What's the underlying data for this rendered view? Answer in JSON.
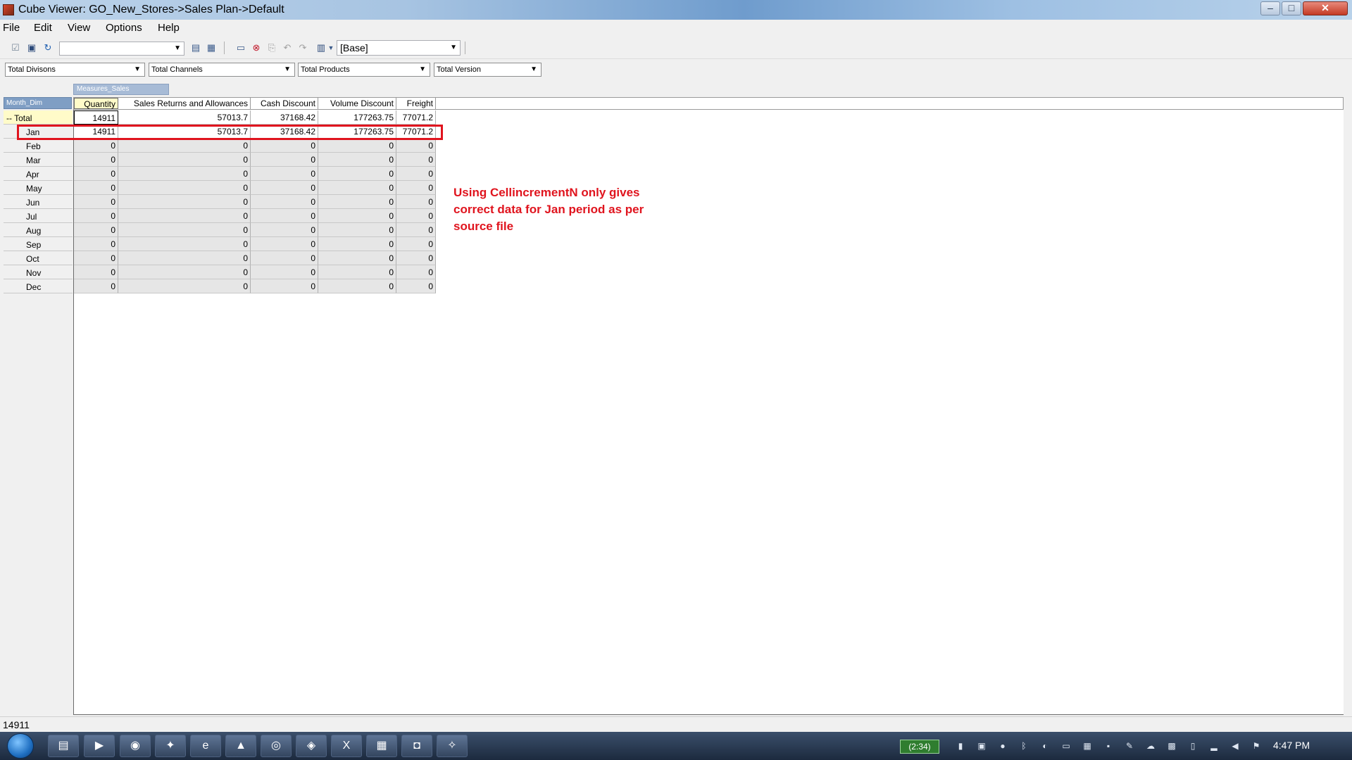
{
  "window": {
    "title": "Cube Viewer: GO_New_Stores->Sales Plan->Default",
    "minimize": "–",
    "maximize": "□",
    "close": "✕"
  },
  "menu": [
    "File",
    "Edit",
    "View",
    "Options",
    "Help"
  ],
  "toolbar": {
    "subset_combo_value": "",
    "view_combo_value": "[Base]"
  },
  "dimensions": {
    "divisions": "Total Divisons",
    "channels": "Total Channels",
    "products": "Total Products",
    "version": "Total Version"
  },
  "grid": {
    "column_dimension": "Measures_Sales",
    "row_dimension": "Month_Dim",
    "columns": [
      "Quantity",
      "Sales Returns and Allowances",
      "Cash Discount",
      "Volume Discount",
      "Freight"
    ],
    "rows": [
      {
        "label": "-- Total",
        "values": [
          "14911",
          "57013.7",
          "37168.42",
          "177263.75",
          "77071.2"
        ]
      },
      {
        "label": "Jan",
        "values": [
          "14911",
          "57013.7",
          "37168.42",
          "177263.75",
          "77071.2"
        ]
      },
      {
        "label": "Feb",
        "values": [
          "0",
          "0",
          "0",
          "0",
          "0"
        ]
      },
      {
        "label": "Mar",
        "values": [
          "0",
          "0",
          "0",
          "0",
          "0"
        ]
      },
      {
        "label": "Apr",
        "values": [
          "0",
          "0",
          "0",
          "0",
          "0"
        ]
      },
      {
        "label": "May",
        "values": [
          "0",
          "0",
          "0",
          "0",
          "0"
        ]
      },
      {
        "label": "Jun",
        "values": [
          "0",
          "0",
          "0",
          "0",
          "0"
        ]
      },
      {
        "label": "Jul",
        "values": [
          "0",
          "0",
          "0",
          "0",
          "0"
        ]
      },
      {
        "label": "Aug",
        "values": [
          "0",
          "0",
          "0",
          "0",
          "0"
        ]
      },
      {
        "label": "Sep",
        "values": [
          "0",
          "0",
          "0",
          "0",
          "0"
        ]
      },
      {
        "label": "Oct",
        "values": [
          "0",
          "0",
          "0",
          "0",
          "0"
        ]
      },
      {
        "label": "Nov",
        "values": [
          "0",
          "0",
          "0",
          "0",
          "0"
        ]
      },
      {
        "label": "Dec",
        "values": [
          "0",
          "0",
          "0",
          "0",
          "0"
        ]
      }
    ]
  },
  "annotation": "Using CellincrementN only gives correct data for Jan period as per source file",
  "status_value": "14911",
  "taskbar": {
    "battery_badge": "(2:34)",
    "clock": "4:47 PM"
  },
  "colors": {
    "highlight": "#e0141e",
    "total_row": "#fffbc9"
  }
}
